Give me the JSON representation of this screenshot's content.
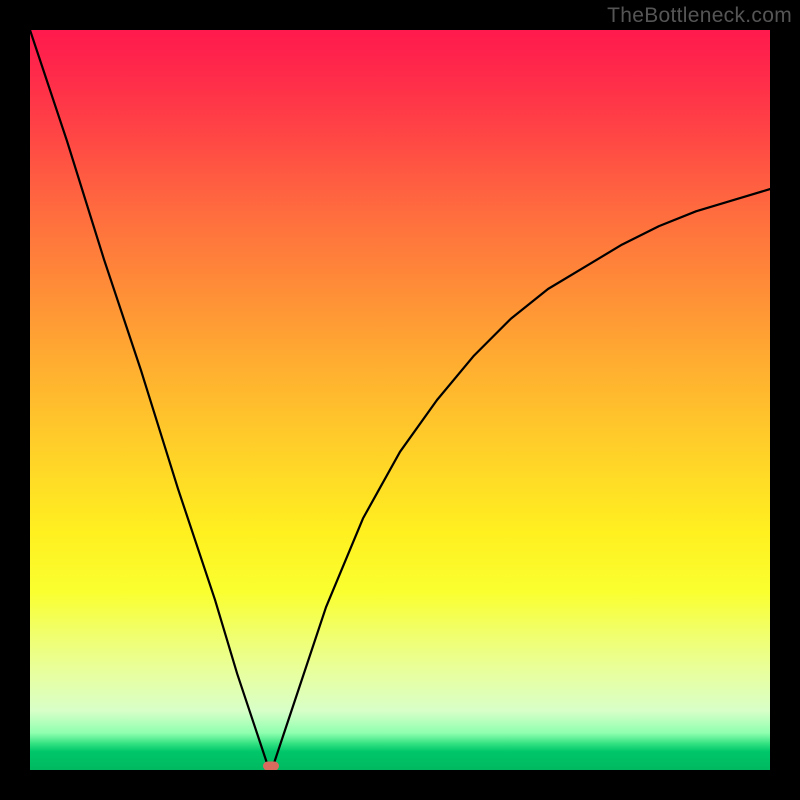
{
  "watermark": "TheBottleneck.com",
  "chart_data": {
    "type": "line",
    "title": "",
    "xlabel": "",
    "ylabel": "",
    "xlim": [
      0,
      100
    ],
    "ylim": [
      0,
      100
    ],
    "grid": false,
    "legend": false,
    "series": [
      {
        "name": "bottleneck-curve",
        "x": [
          0,
          5,
          10,
          15,
          20,
          25,
          28,
          30,
          31,
          32,
          32.5,
          33,
          34,
          36,
          40,
          45,
          50,
          55,
          60,
          65,
          70,
          75,
          80,
          85,
          90,
          95,
          100
        ],
        "y": [
          100,
          85,
          69,
          54,
          38,
          23,
          13,
          7,
          4,
          1,
          0,
          1,
          4,
          10,
          22,
          34,
          43,
          50,
          56,
          61,
          65,
          68,
          71,
          73.5,
          75.5,
          77,
          78.5
        ]
      }
    ],
    "marker": {
      "x": 32.5,
      "y": 0
    },
    "background_gradient": {
      "stops": [
        {
          "pos": 0.0,
          "color": "#ff1a4d"
        },
        {
          "pos": 0.5,
          "color": "#ffc028"
        },
        {
          "pos": 0.75,
          "color": "#fff020"
        },
        {
          "pos": 0.95,
          "color": "#8fffaf"
        },
        {
          "pos": 1.0,
          "color": "#00b85f"
        }
      ]
    }
  }
}
